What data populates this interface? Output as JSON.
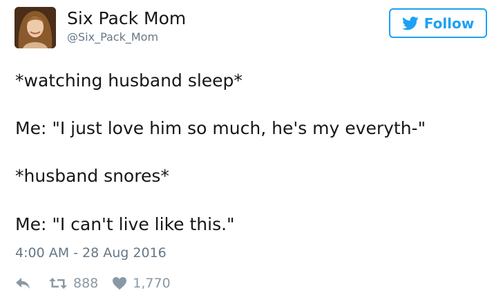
{
  "user": {
    "display_name": "Six Pack Mom",
    "handle": "@Six_Pack_Mom"
  },
  "follow_button": {
    "label": "Follow"
  },
  "tweet": {
    "lines": [
      "*watching husband sleep*",
      "Me: \"I just love him so much, he's my everyth-\"",
      "*husband snores*",
      "Me: \"I can't live like this.\""
    ],
    "timestamp": "4:00 AM - 28 Aug 2016"
  },
  "stats": {
    "retweets": "888",
    "likes": "1,770"
  },
  "icons": {
    "follow": "twitter-bird-icon",
    "reply": "reply-icon",
    "retweet": "retweet-icon",
    "like": "heart-icon"
  },
  "colors": {
    "accent": "#1da1f2",
    "text": "#14171a",
    "muted": "#657786",
    "action_gray": "#8899a6"
  }
}
